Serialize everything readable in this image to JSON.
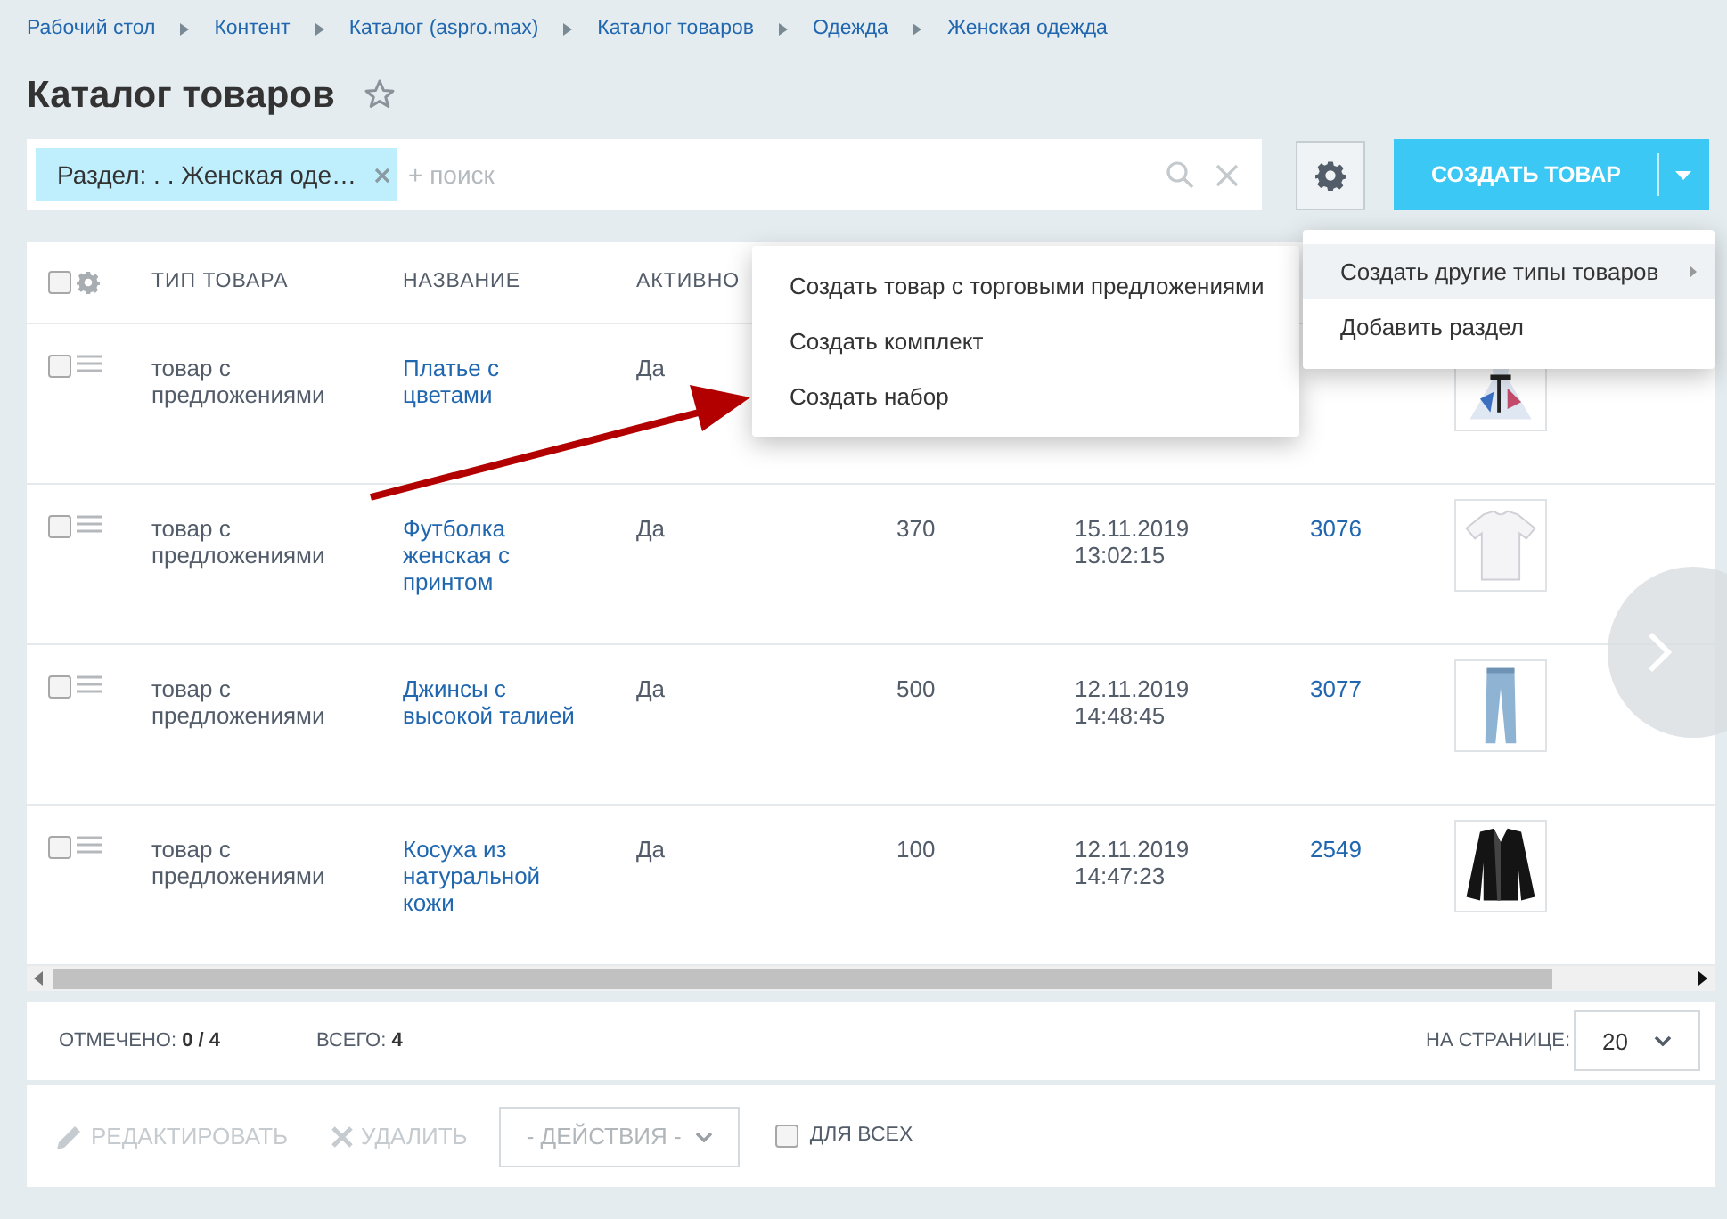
{
  "breadcrumbs": [
    "Рабочий стол",
    "Контент",
    "Каталог (aspro.max)",
    "Каталог товаров",
    "Одежда",
    "Женская одежда"
  ],
  "title": "Каталог товаров",
  "filter": {
    "tag": "Раздел: . . Женская оде…",
    "placeholder": "+ поиск"
  },
  "create_button": "СОЗДАТЬ ТОВАР",
  "table": {
    "select_all_checked": false,
    "columns": [
      "ТИП ТОВАРА",
      "НАЗВАНИЕ",
      "АКТИВНО"
    ],
    "rows": [
      {
        "checked": false,
        "type": "товар с\nпредложениями",
        "name": "Платье с\nцветами",
        "active": "Да"
      },
      {
        "type": "товар с\nпредложениями",
        "name": "Футболка\nженская с\nпринтом",
        "active": "Да",
        "quantity": "370",
        "date": "15.11.2019\n13:02:15",
        "id": "3076",
        "checked": false
      },
      {
        "type": "товар с\nпредложениями",
        "name": "Джинсы с\nвысокой талией",
        "active": "Да",
        "quantity": "500",
        "date": "12.11.2019\n14:48:45",
        "id": "3077",
        "checked": false
      },
      {
        "type": "товар с\nпредложениями",
        "name": "Косуха из\nнатуральной\nкожи",
        "active": "Да",
        "quantity": "100",
        "date": "12.11.2019\n14:47:23",
        "id": "2549",
        "checked": false
      }
    ]
  },
  "create_menu": [
    {
      "label": "Создать другие типы товаров",
      "selected": true,
      "submenu": true
    },
    {
      "label": "Добавить раздел",
      "selected": false,
      "submenu": false
    }
  ],
  "types_menu": [
    "Создать товар с торговыми предложениями",
    "Создать комплект",
    "Создать набор"
  ],
  "footer": {
    "marked_label": "ОТМЕЧЕНО:",
    "marked": "0 / 4",
    "total_label": "ВСЕГО:",
    "total": "4",
    "per_page_label": "НА СТРАНИЦЕ:",
    "per_page": "20"
  },
  "actions": {
    "edit": {
      "label": "РЕДАКТИРОВАТЬ",
      "disabled": true
    },
    "delete": {
      "label": "УДАЛИТЬ",
      "disabled": true
    },
    "select": "- ДЕЙСТВИЯ -",
    "for_all": {
      "label": "ДЛЯ ВСЕХ",
      "checked": false
    }
  }
}
